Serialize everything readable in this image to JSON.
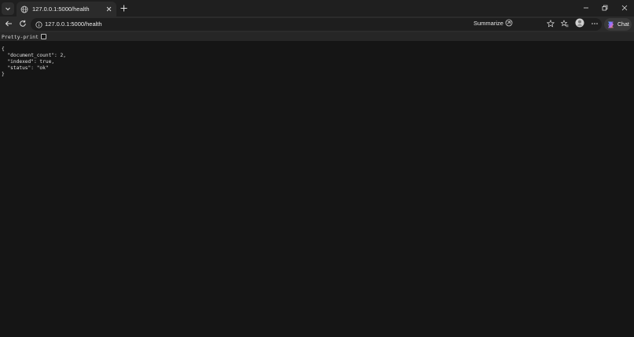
{
  "tab": {
    "title": "127.0.0.1:5000/health"
  },
  "address_bar": {
    "url": "127.0.0.1:5000/health"
  },
  "toolbar": {
    "summarize_label": "Summarize",
    "chat_label": "Chat"
  },
  "page": {
    "pretty_print_label": "Pretty-print",
    "pretty_print_checked": false,
    "json_lines": [
      "{",
      "  \"document_count\": 2,",
      "  \"indexed\": true,",
      "  \"status\": \"ok\"",
      "}"
    ]
  },
  "icons": [
    "tab-list-icon",
    "globe-icon",
    "close-icon",
    "plus-icon",
    "minimize-icon",
    "restore-icon",
    "back-icon",
    "reload-icon",
    "info-icon",
    "summarize-icon",
    "favorite-star-icon",
    "favorites-icon",
    "profile-icon",
    "more-icon",
    "copilot-icon"
  ],
  "colors": {
    "page_background": "#151515",
    "toolbar": "#2b2b2b",
    "titlebar": "#1f1f1f"
  }
}
